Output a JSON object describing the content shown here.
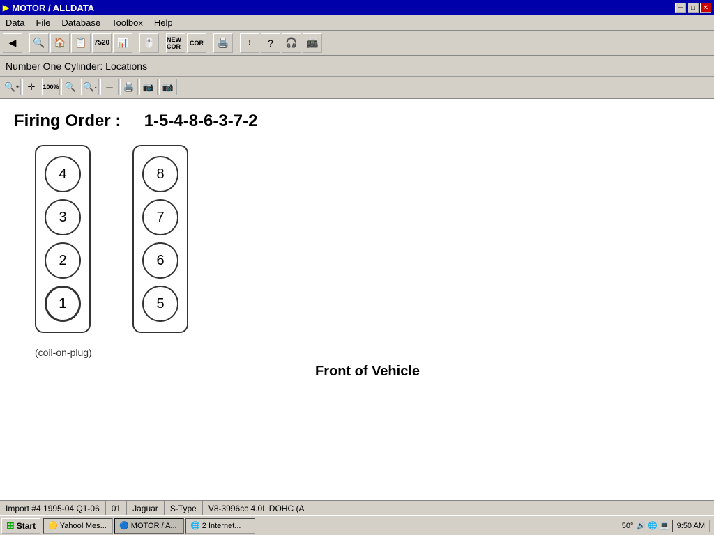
{
  "title_bar": {
    "title": "MOTOR / ALLDATA",
    "minimize_label": "─",
    "maximize_label": "□",
    "close_label": "✕"
  },
  "menu": {
    "items": [
      "Data",
      "File",
      "Database",
      "Toolbox",
      "Help"
    ]
  },
  "page_header": {
    "text": "Number One Cylinder:  Locations"
  },
  "content": {
    "firing_order_label": "Firing Order :",
    "firing_order_value": "1-5-4-8-6-3-7-2",
    "left_bank": {
      "cylinders": [
        "4",
        "3",
        "2",
        "1"
      ],
      "active": "1"
    },
    "right_bank": {
      "cylinders": [
        "8",
        "7",
        "6",
        "5"
      ],
      "active": null
    },
    "coil_note": "(coil-on-plug)",
    "front_label": "Front of Vehicle"
  },
  "status_bar": {
    "segment1": "Import #4 1995-04 Q1-06",
    "segment2": "01",
    "segment3": "Jaguar",
    "segment4": "S-Type",
    "segment5": "V8-3996cc 4.0L DOHC (A"
  },
  "taskbar": {
    "start_label": "Start",
    "items": [
      {
        "label": "Yahoo! Mes...",
        "icon": "🟡"
      },
      {
        "label": "MOTOR / A...",
        "icon": "🔵"
      },
      {
        "label": "2 Internet...",
        "icon": "🌐"
      }
    ],
    "clock": "9:50 AM",
    "temp": "50°"
  }
}
